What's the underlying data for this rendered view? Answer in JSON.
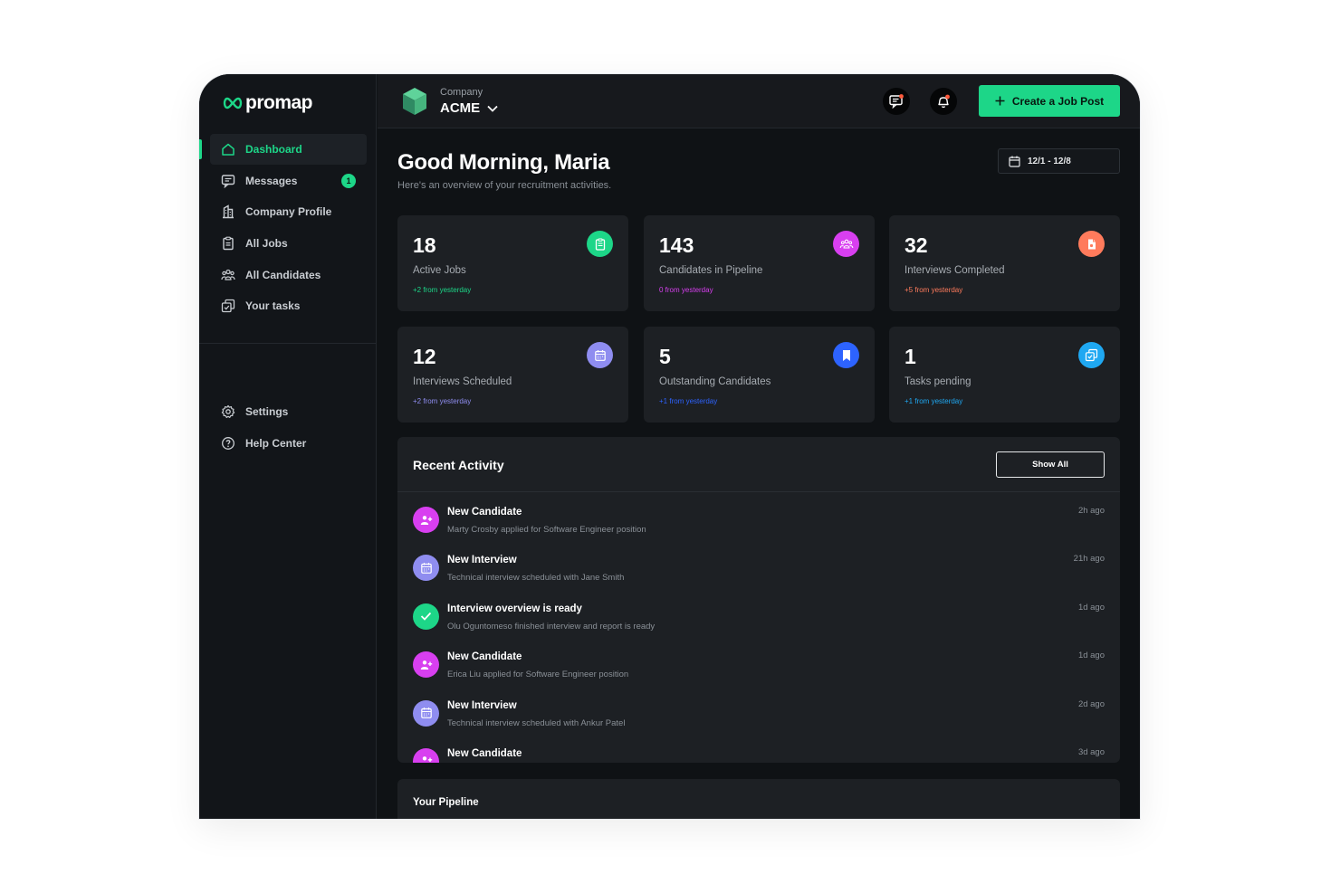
{
  "brand": {
    "name": "promap",
    "accent": "#1dd688"
  },
  "sidebar": {
    "items": [
      {
        "label": "Dashboard",
        "icon": "home-icon",
        "active": true
      },
      {
        "label": "Messages",
        "icon": "chat-icon",
        "badge": "1"
      },
      {
        "label": "Company Profile",
        "icon": "building-icon"
      },
      {
        "label": "All Jobs",
        "icon": "clipboard-icon"
      },
      {
        "label": "All Candidates",
        "icon": "users-icon"
      },
      {
        "label": "Your tasks",
        "icon": "tasks-icon"
      }
    ],
    "bottom_items": [
      {
        "label": "Settings",
        "icon": "gear-icon"
      },
      {
        "label": "Help Center",
        "icon": "help-icon"
      }
    ]
  },
  "header": {
    "company_label": "Company",
    "company_name": "ACME",
    "create_button": "Create a Job Post"
  },
  "main": {
    "greeting": "Good Morning, Maria",
    "subtitle": "Here's an overview of your recruitment activities.",
    "date_range": "12/1 - 12/8"
  },
  "stats": [
    {
      "value": "18",
      "label": "Active Jobs",
      "delta": "+2 from yesterday",
      "color": "#1dd688",
      "icon": "clipboard-icon"
    },
    {
      "value": "143",
      "label": "Candidates in Pipeline",
      "delta": "0 from yesterday",
      "color": "#d83ff0",
      "icon": "group-icon"
    },
    {
      "value": "32",
      "label": "Interviews Completed",
      "delta": "+5 from yesterday",
      "color": "#ff7b5c",
      "icon": "document-icon"
    },
    {
      "value": "12",
      "label": "Interviews Scheduled",
      "delta": "+2 from yesterday",
      "color": "#8f8df0",
      "icon": "calendar-icon"
    },
    {
      "value": "5",
      "label": "Outstanding Candidates",
      "delta": "+1 from yesterday",
      "color": "#2d63ff",
      "icon": "bookmark-icon"
    },
    {
      "value": "1",
      "label": "Tasks pending",
      "delta": "+1 from yesterday",
      "color": "#1fa8f2",
      "icon": "tasks-icon"
    }
  ],
  "activity": {
    "title": "Recent Activity",
    "show_all": "Show All",
    "items": [
      {
        "title": "New Candidate",
        "desc": "Marty Crosby applied for Software Engineer position",
        "time": "2h ago",
        "type": "candidate"
      },
      {
        "title": "New Interview",
        "desc": "Technical interview scheduled with Jane Smith",
        "time": "21h ago",
        "type": "interview"
      },
      {
        "title": "Interview overview is ready",
        "desc": "Olu Oguntomeso finished interview and report is ready",
        "time": "1d ago",
        "type": "ready"
      },
      {
        "title": "New Candidate",
        "desc": "Erica Liu applied for Software Engineer position",
        "time": "1d ago",
        "type": "candidate"
      },
      {
        "title": "New Interview",
        "desc": "Technical interview scheduled with Ankur Patel",
        "time": "2d ago",
        "type": "interview"
      },
      {
        "title": "New Candidate",
        "desc": "",
        "time": "3d ago",
        "type": "candidate"
      }
    ]
  },
  "pipeline": {
    "title": "Your Pipeline"
  }
}
